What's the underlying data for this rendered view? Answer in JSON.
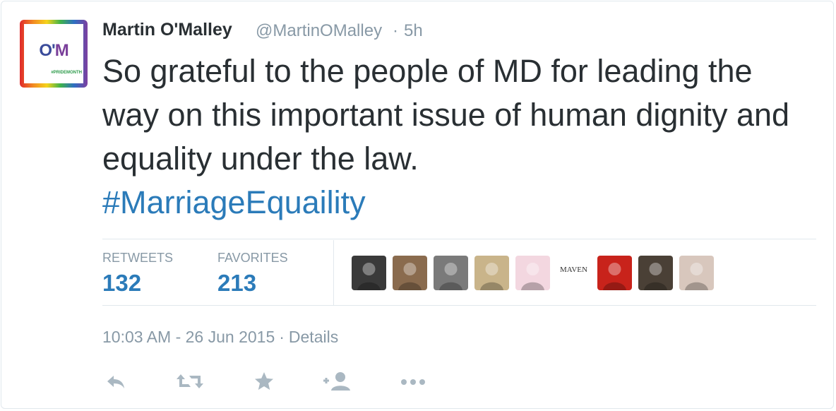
{
  "author": {
    "name": "Martin O'Malley",
    "handle": "@MartinOMalley",
    "time_ago": "5h",
    "avatar_logo_o": "O'",
    "avatar_logo_m": "M",
    "avatar_subtext": "#PRIDEMONTH"
  },
  "tweet": {
    "text": "So grateful to the people of MD for leading the way on this important issue of human dignity and equality under the law.",
    "hashtag": "#MarriageEquaility"
  },
  "stats": {
    "retweets_label": "RETWEETS",
    "retweets_value": "132",
    "favorites_label": "FAVORITES",
    "favorites_value": "213"
  },
  "favoriters": [
    {
      "icon": "user-avatar-1",
      "color": "#3a3a3a"
    },
    {
      "icon": "user-avatar-2",
      "color": "#8a6b4e"
    },
    {
      "icon": "user-avatar-3",
      "color": "#7a7a7a"
    },
    {
      "icon": "user-avatar-4",
      "color": "#c9b48a"
    },
    {
      "icon": "user-avatar-5",
      "color": "#f3d7e0"
    },
    {
      "icon": "user-avatar-6",
      "color": "#ffffff",
      "label": "MAVEN"
    },
    {
      "icon": "user-avatar-7",
      "color": "#c8231b"
    },
    {
      "icon": "user-avatar-8",
      "color": "#4a4036"
    },
    {
      "icon": "user-avatar-9",
      "color": "#d8c7bd"
    }
  ],
  "meta": {
    "timestamp": "10:03 AM - 26 Jun 2015",
    "details_label": "Details"
  },
  "actions": [
    "reply-icon",
    "retweet-icon",
    "favorite-icon",
    "follow-icon",
    "more-icon"
  ],
  "colors": {
    "link": "#2b7bb9",
    "text": "#292f33",
    "muted": "#8899a6",
    "action": "#aab8c2"
  }
}
